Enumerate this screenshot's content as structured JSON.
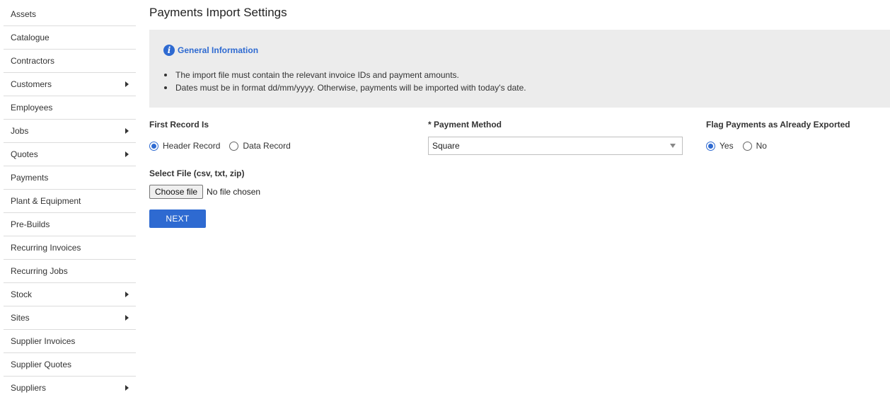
{
  "sidebar": {
    "items": [
      {
        "label": "Assets",
        "has_submenu": false
      },
      {
        "label": "Catalogue",
        "has_submenu": false
      },
      {
        "label": "Contractors",
        "has_submenu": false
      },
      {
        "label": "Customers",
        "has_submenu": true
      },
      {
        "label": "Employees",
        "has_submenu": false
      },
      {
        "label": "Jobs",
        "has_submenu": true
      },
      {
        "label": "Quotes",
        "has_submenu": true
      },
      {
        "label": "Payments",
        "has_submenu": false
      },
      {
        "label": "Plant & Equipment",
        "has_submenu": false
      },
      {
        "label": "Pre-Builds",
        "has_submenu": false
      },
      {
        "label": "Recurring Invoices",
        "has_submenu": false
      },
      {
        "label": "Recurring Jobs",
        "has_submenu": false
      },
      {
        "label": "Stock",
        "has_submenu": true
      },
      {
        "label": "Sites",
        "has_submenu": true
      },
      {
        "label": "Supplier Invoices",
        "has_submenu": false
      },
      {
        "label": "Supplier Quotes",
        "has_submenu": false
      },
      {
        "label": "Suppliers",
        "has_submenu": true
      }
    ]
  },
  "page": {
    "title": "Payments Import Settings"
  },
  "info": {
    "icon": "info-icon",
    "title": "General Information",
    "bullets": [
      "The import file must contain the relevant invoice IDs and payment amounts.",
      "Dates must be in format dd/mm/yyyy. Otherwise, payments will be imported with today's date."
    ]
  },
  "form": {
    "first_record": {
      "label": "First Record Is",
      "options": [
        "Header Record",
        "Data Record"
      ],
      "selected": "Header Record"
    },
    "payment_method": {
      "label": "* Payment Method",
      "value": "Square"
    },
    "flag_exported": {
      "label": "Flag Payments as Already Exported",
      "options": [
        "Yes",
        "No"
      ],
      "selected": "Yes"
    },
    "file": {
      "label": "Select File (csv, txt, zip)",
      "button": "Choose file",
      "status": "No file chosen"
    },
    "next_label": "NEXT"
  },
  "colors": {
    "accent": "#2e6ad1",
    "info_bg": "#ececec"
  }
}
